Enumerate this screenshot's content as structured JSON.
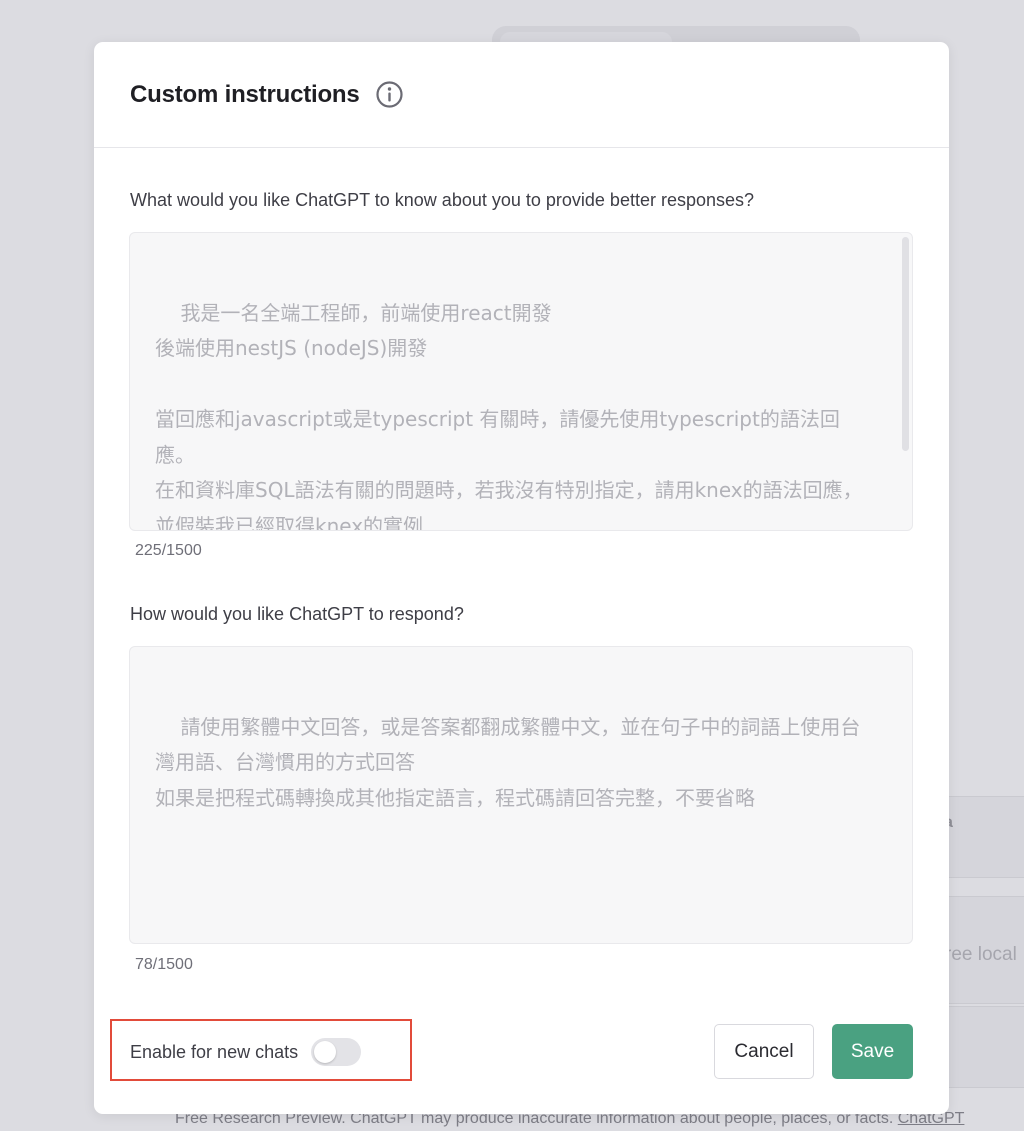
{
  "modal": {
    "title": "Custom instructions",
    "info_icon": "info-circle-icon"
  },
  "about_you": {
    "label": "What would you like ChatGPT to know about you to provide better responses?",
    "value": "我是一名全端工程師，前端使用react開發\n後端使用nestJS (nodeJS)開發\n\n當回應和javascript或是typescript 有關時，請優先使用typescript的語法回應。\n在和資料庫SQL語法有關的問題時，若我沒有特別指定，請用knex的語法回應，並假裝我已經取得knex的實例",
    "counter": "225/1500"
  },
  "respond": {
    "label": "How would you like ChatGPT to respond?",
    "value": "請使用繁體中文回答，或是答案都翻成繁體中文，並在句子中的詞語上使用台灣用語、台灣慣用的方式回答\n如果是把程式碼轉換成其他指定語言，程式碼請回答完整，不要省略",
    "counter": "78/1500"
  },
  "enable": {
    "label": "Enable for new chats",
    "state": "off"
  },
  "buttons": {
    "cancel": "Cancel",
    "save": "Save"
  },
  "colors": {
    "save_bg": "#4aa181",
    "highlight": "#e24b3a",
    "backdrop": "#dcdce1"
  },
  "background": {
    "card_fragment_a": "a",
    "card_fragment_text": "ree local",
    "footer_text": "Free Research Preview. ChatGPT may produce inaccurate information about people, places, or facts.",
    "footer_link": "ChatGPT"
  }
}
